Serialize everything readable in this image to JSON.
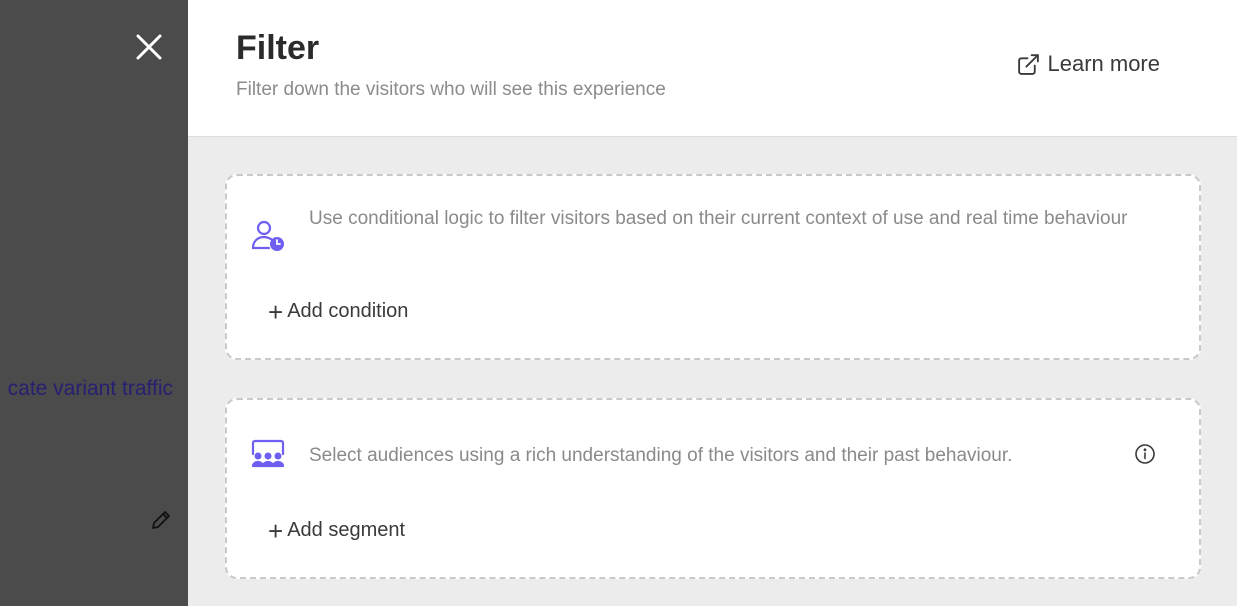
{
  "background": {
    "link_text": "cate variant traffic",
    "close_icon": "close-icon",
    "edit_icon": "pencil-icon"
  },
  "panel": {
    "title": "Filter",
    "subtitle": "Filter down the visitors who will see this experience",
    "learn_more": {
      "label": "Learn more",
      "icon": "external-link-icon"
    }
  },
  "cards": [
    {
      "icon": "user-clock-icon",
      "text": "Use conditional logic to filter visitors based on their current context of use and real time behaviour",
      "action": {
        "plus": "+",
        "label": "Add condition"
      }
    },
    {
      "icon": "audience-icon",
      "text": "Select audiences using a rich understanding of the visitors and their past behaviour.",
      "info_icon": "info-icon",
      "action": {
        "plus": "+",
        "label": "Add segment"
      }
    }
  ],
  "colors": {
    "accent": "#6e5ff0",
    "overlay": "#4b4b4b",
    "link": "#262070"
  }
}
